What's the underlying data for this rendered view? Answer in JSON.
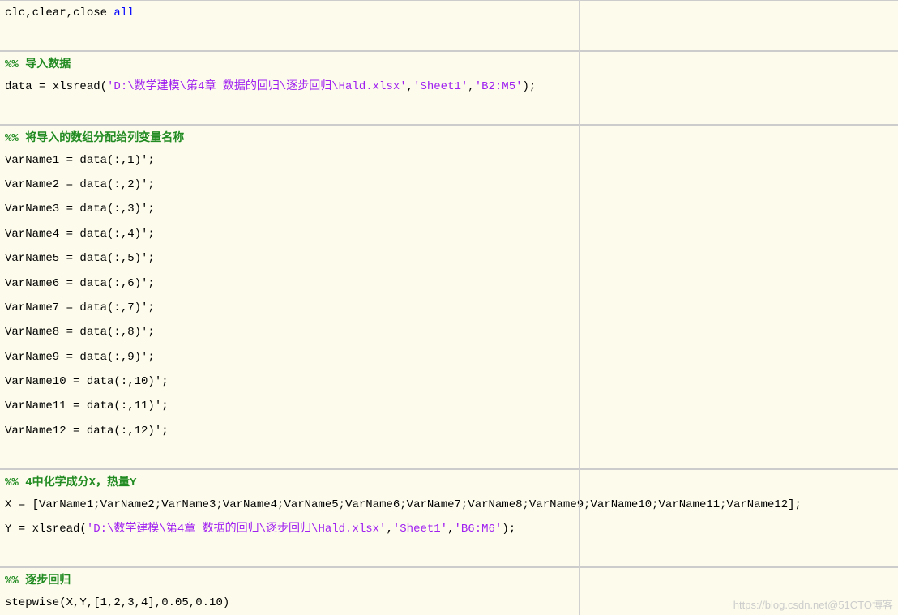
{
  "block0": {
    "line1_part1": "clc,clear,close ",
    "line1_kw": "all"
  },
  "block1": {
    "title": "%% 导入数据",
    "line1_a": "data = xlsread(",
    "line1_str1": "'D:\\数学建模\\第4章 数据的回归\\逐步回归\\Hald.xlsx'",
    "line1_b": ",",
    "line1_str2": "'Sheet1'",
    "line1_c": ",",
    "line1_str3": "'B2:M5'",
    "line1_d": ");"
  },
  "block2": {
    "title": "%% 将导入的数组分配给列变量名称",
    "lines": [
      "VarName1 = data(:,1)';",
      "VarName2 = data(:,2)';",
      "VarName3 = data(:,3)';",
      "VarName4 = data(:,4)';",
      "VarName5 = data(:,5)';",
      "VarName6 = data(:,6)';",
      "VarName7 = data(:,7)';",
      "VarName8 = data(:,8)';",
      "VarName9 = data(:,9)';",
      "VarName10 = data(:,10)';",
      "VarName11 = data(:,11)';",
      "VarName12 = data(:,12)';"
    ]
  },
  "block3": {
    "title": "%% 4中化学成分X，热量Y",
    "line1": "X = [VarName1;VarName2;VarName3;VarName4;VarName5;VarName6;VarName7;VarName8;VarName9;VarName10;VarName11;VarName12];",
    "line2_a": "Y = xlsread(",
    "line2_str1": "'D:\\数学建模\\第4章 数据的回归\\逐步回归\\Hald.xlsx'",
    "line2_b": ",",
    "line2_str2": "'Sheet1'",
    "line2_c": ",",
    "line2_str3": "'B6:M6'",
    "line2_d": ");"
  },
  "block4": {
    "title": "%% 逐步回归",
    "line1": "stepwise(X,Y,[1,2,3,4],0.05,0.10)"
  },
  "watermark": "https://blog.csdn.net@51CTO博客"
}
